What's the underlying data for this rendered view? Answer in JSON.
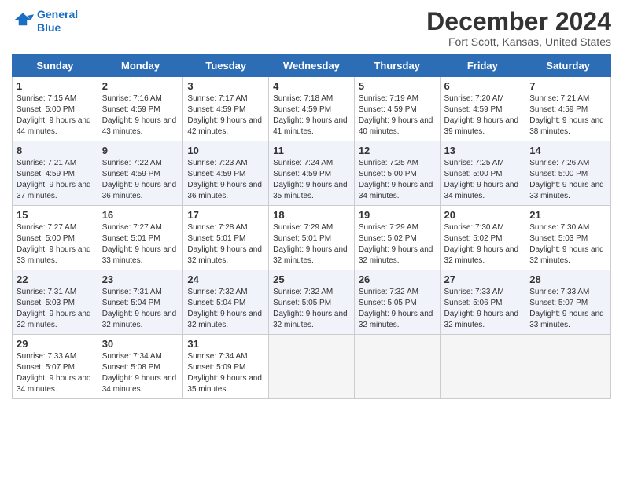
{
  "logo": {
    "line1": "General",
    "line2": "Blue"
  },
  "title": "December 2024",
  "subtitle": "Fort Scott, Kansas, United States",
  "weekdays": [
    "Sunday",
    "Monday",
    "Tuesday",
    "Wednesday",
    "Thursday",
    "Friday",
    "Saturday"
  ],
  "weeks": [
    [
      {
        "day": 1,
        "sunrise": "7:15 AM",
        "sunset": "5:00 PM",
        "daylight": "9 hours and 44 minutes."
      },
      {
        "day": 2,
        "sunrise": "7:16 AM",
        "sunset": "4:59 PM",
        "daylight": "9 hours and 43 minutes."
      },
      {
        "day": 3,
        "sunrise": "7:17 AM",
        "sunset": "4:59 PM",
        "daylight": "9 hours and 42 minutes."
      },
      {
        "day": 4,
        "sunrise": "7:18 AM",
        "sunset": "4:59 PM",
        "daylight": "9 hours and 41 minutes."
      },
      {
        "day": 5,
        "sunrise": "7:19 AM",
        "sunset": "4:59 PM",
        "daylight": "9 hours and 40 minutes."
      },
      {
        "day": 6,
        "sunrise": "7:20 AM",
        "sunset": "4:59 PM",
        "daylight": "9 hours and 39 minutes."
      },
      {
        "day": 7,
        "sunrise": "7:21 AM",
        "sunset": "4:59 PM",
        "daylight": "9 hours and 38 minutes."
      }
    ],
    [
      {
        "day": 8,
        "sunrise": "7:21 AM",
        "sunset": "4:59 PM",
        "daylight": "9 hours and 37 minutes."
      },
      {
        "day": 9,
        "sunrise": "7:22 AM",
        "sunset": "4:59 PM",
        "daylight": "9 hours and 36 minutes."
      },
      {
        "day": 10,
        "sunrise": "7:23 AM",
        "sunset": "4:59 PM",
        "daylight": "9 hours and 36 minutes."
      },
      {
        "day": 11,
        "sunrise": "7:24 AM",
        "sunset": "4:59 PM",
        "daylight": "9 hours and 35 minutes."
      },
      {
        "day": 12,
        "sunrise": "7:25 AM",
        "sunset": "5:00 PM",
        "daylight": "9 hours and 34 minutes."
      },
      {
        "day": 13,
        "sunrise": "7:25 AM",
        "sunset": "5:00 PM",
        "daylight": "9 hours and 34 minutes."
      },
      {
        "day": 14,
        "sunrise": "7:26 AM",
        "sunset": "5:00 PM",
        "daylight": "9 hours and 33 minutes."
      }
    ],
    [
      {
        "day": 15,
        "sunrise": "7:27 AM",
        "sunset": "5:00 PM",
        "daylight": "9 hours and 33 minutes."
      },
      {
        "day": 16,
        "sunrise": "7:27 AM",
        "sunset": "5:01 PM",
        "daylight": "9 hours and 33 minutes."
      },
      {
        "day": 17,
        "sunrise": "7:28 AM",
        "sunset": "5:01 PM",
        "daylight": "9 hours and 32 minutes."
      },
      {
        "day": 18,
        "sunrise": "7:29 AM",
        "sunset": "5:01 PM",
        "daylight": "9 hours and 32 minutes."
      },
      {
        "day": 19,
        "sunrise": "7:29 AM",
        "sunset": "5:02 PM",
        "daylight": "9 hours and 32 minutes."
      },
      {
        "day": 20,
        "sunrise": "7:30 AM",
        "sunset": "5:02 PM",
        "daylight": "9 hours and 32 minutes."
      },
      {
        "day": 21,
        "sunrise": "7:30 AM",
        "sunset": "5:03 PM",
        "daylight": "9 hours and 32 minutes."
      }
    ],
    [
      {
        "day": 22,
        "sunrise": "7:31 AM",
        "sunset": "5:03 PM",
        "daylight": "9 hours and 32 minutes."
      },
      {
        "day": 23,
        "sunrise": "7:31 AM",
        "sunset": "5:04 PM",
        "daylight": "9 hours and 32 minutes."
      },
      {
        "day": 24,
        "sunrise": "7:32 AM",
        "sunset": "5:04 PM",
        "daylight": "9 hours and 32 minutes."
      },
      {
        "day": 25,
        "sunrise": "7:32 AM",
        "sunset": "5:05 PM",
        "daylight": "9 hours and 32 minutes."
      },
      {
        "day": 26,
        "sunrise": "7:32 AM",
        "sunset": "5:05 PM",
        "daylight": "9 hours and 32 minutes."
      },
      {
        "day": 27,
        "sunrise": "7:33 AM",
        "sunset": "5:06 PM",
        "daylight": "9 hours and 32 minutes."
      },
      {
        "day": 28,
        "sunrise": "7:33 AM",
        "sunset": "5:07 PM",
        "daylight": "9 hours and 33 minutes."
      }
    ],
    [
      {
        "day": 29,
        "sunrise": "7:33 AM",
        "sunset": "5:07 PM",
        "daylight": "9 hours and 34 minutes."
      },
      {
        "day": 30,
        "sunrise": "7:34 AM",
        "sunset": "5:08 PM",
        "daylight": "9 hours and 34 minutes."
      },
      {
        "day": 31,
        "sunrise": "7:34 AM",
        "sunset": "5:09 PM",
        "daylight": "9 hours and 35 minutes."
      },
      null,
      null,
      null,
      null
    ]
  ],
  "labels": {
    "sunrise": "Sunrise:",
    "sunset": "Sunset:",
    "daylight": "Daylight:"
  }
}
